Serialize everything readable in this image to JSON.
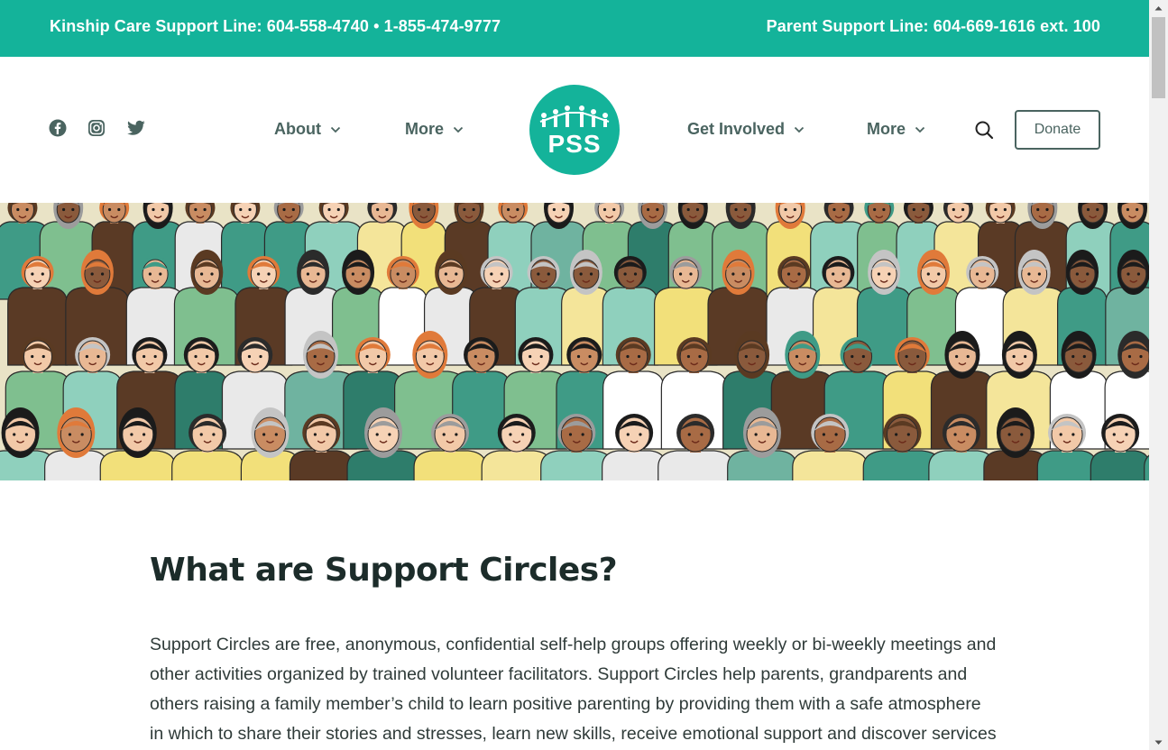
{
  "topbar": {
    "kinship_line": "Kinship Care Support Line: 604-558-4740 • 1-855-474-9777",
    "parent_line": "Parent Support Line: 604-669-1616 ext. 100"
  },
  "social": {
    "icons": [
      "facebook-icon",
      "instagram-icon",
      "twitter-icon"
    ]
  },
  "nav": {
    "about": "About",
    "more_left": "More",
    "get_involved": "Get Involved",
    "more_right": "More"
  },
  "logo": {
    "text": "PSS"
  },
  "header": {
    "donate_label": "Donate"
  },
  "main": {
    "heading": "What are Support Circles?",
    "paragraph": "Support Circles are free, anonymous, confidential self-help groups offering weekly or bi-weekly meetings and other activities organized by trained volunteer facilitators. Support Circles help parents, grandparents and others raising a family member’s child to learn positive parenting by providing them with a safe atmosphere in which to share their stories and stresses, learn new skills, receive emotional support and discover services and resources. The Circles strengthen the first link in a chain that connects positive"
  },
  "colors": {
    "brand": "#14b39a",
    "nav_text": "#4a6460",
    "heading": "#1c2c2a",
    "body_text": "#2f3b39"
  }
}
